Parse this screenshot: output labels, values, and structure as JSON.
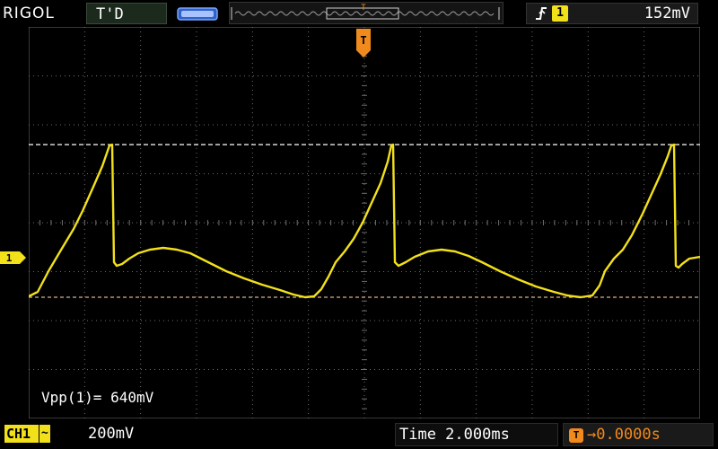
{
  "topbar": {
    "brand": "RIGOL",
    "trigger_status": "T'D",
    "trigger_position_label": "T",
    "trigger_source": "1",
    "trigger_level": "152mV"
  },
  "screen": {
    "trigger_marker": "T",
    "ch1_marker": "1",
    "measurement": "Vpp(1)= 640mV"
  },
  "bottombar": {
    "channel": "CH1",
    "coupling": "~",
    "scale": "200mV",
    "timebase": "Time 2.000ms",
    "offset_icon": "T",
    "offset": "→0.0000s"
  },
  "colors": {
    "trace": "#f2e01a",
    "grid": "#6e6e6e",
    "trigger": "#f08a1c",
    "cursor": "#ffffff"
  },
  "icons": [
    "memory-depth-icon",
    "trigger-slope-rising-icon",
    "trigger-position-marker-icon",
    "channel1-ground-marker-icon"
  ]
}
